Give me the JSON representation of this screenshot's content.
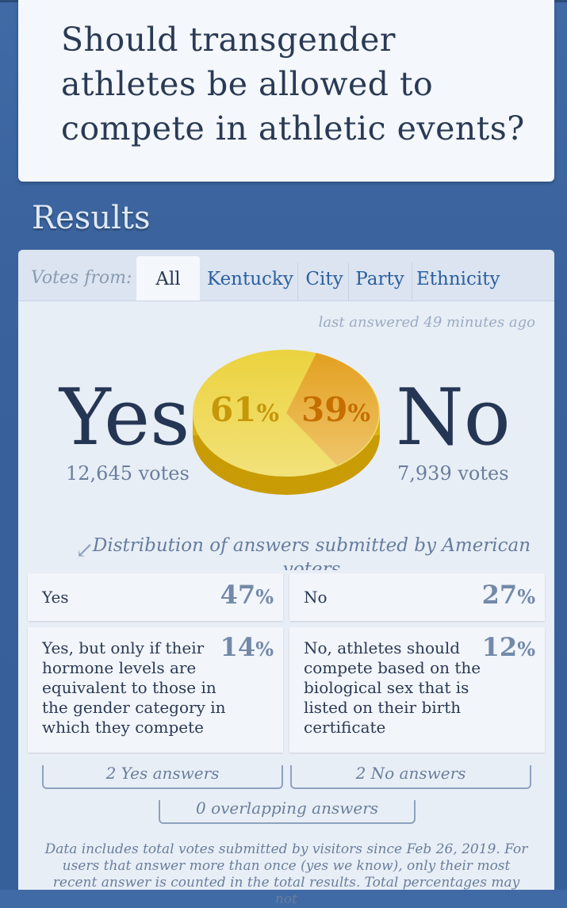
{
  "question": "Should transgender athletes be allowed to compete in athletic events?",
  "results_heading": "Results",
  "tabs": {
    "label": "Votes from:",
    "items": [
      "All",
      "Kentucky",
      "City",
      "Party",
      "Ethnicity"
    ],
    "active": "All"
  },
  "last_answered": "last answered 49 minutes ago",
  "summary": {
    "yes_label": "Yes",
    "no_label": "No",
    "yes_votes": "12,645 votes",
    "no_votes": "7,939 votes",
    "yes_pct": "61",
    "no_pct": "39",
    "pct_sign": "%"
  },
  "pie_colors": {
    "yes": "#e8c31c",
    "no": "#e5a01a"
  },
  "distribution_caption": "Distribution of answers submitted by American voters",
  "answers": [
    {
      "text": "Yes",
      "pct": "47"
    },
    {
      "text": "No",
      "pct": "27"
    },
    {
      "text": "Yes, but only if their hormone levels are equivalent to those in the gender category in which they compete",
      "pct": "14"
    },
    {
      "text": "No, athletes should compete based on the biological sex that is listed on their birth certificate",
      "pct": "12"
    }
  ],
  "brackets": {
    "yes": "2 Yes answers",
    "no": "2 No answers",
    "overlap": "0 overlapping answers"
  },
  "footnote": "Data includes total votes submitted by visitors since Feb 26, 2019. For users that answer more than once (yes we know), only their most recent answer is counted in the total results. Total percentages may not"
}
